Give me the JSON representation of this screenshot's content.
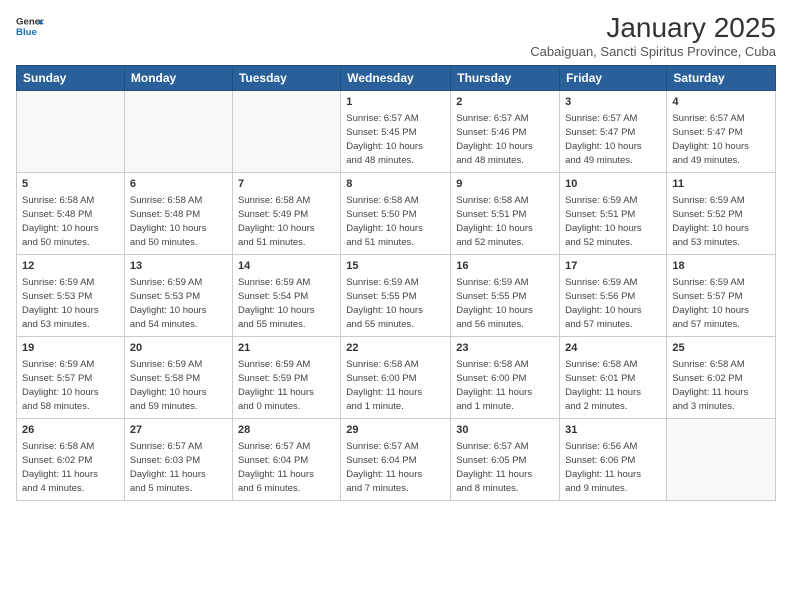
{
  "header": {
    "logo_line1": "General",
    "logo_line2": "Blue",
    "month": "January 2025",
    "location": "Cabaiguan, Sancti Spiritus Province, Cuba"
  },
  "days_of_week": [
    "Sunday",
    "Monday",
    "Tuesday",
    "Wednesday",
    "Thursday",
    "Friday",
    "Saturday"
  ],
  "weeks": [
    [
      {
        "day": "",
        "info": ""
      },
      {
        "day": "",
        "info": ""
      },
      {
        "day": "",
        "info": ""
      },
      {
        "day": "1",
        "info": "Sunrise: 6:57 AM\nSunset: 5:45 PM\nDaylight: 10 hours\nand 48 minutes."
      },
      {
        "day": "2",
        "info": "Sunrise: 6:57 AM\nSunset: 5:46 PM\nDaylight: 10 hours\nand 48 minutes."
      },
      {
        "day": "3",
        "info": "Sunrise: 6:57 AM\nSunset: 5:47 PM\nDaylight: 10 hours\nand 49 minutes."
      },
      {
        "day": "4",
        "info": "Sunrise: 6:57 AM\nSunset: 5:47 PM\nDaylight: 10 hours\nand 49 minutes."
      }
    ],
    [
      {
        "day": "5",
        "info": "Sunrise: 6:58 AM\nSunset: 5:48 PM\nDaylight: 10 hours\nand 50 minutes."
      },
      {
        "day": "6",
        "info": "Sunrise: 6:58 AM\nSunset: 5:48 PM\nDaylight: 10 hours\nand 50 minutes."
      },
      {
        "day": "7",
        "info": "Sunrise: 6:58 AM\nSunset: 5:49 PM\nDaylight: 10 hours\nand 51 minutes."
      },
      {
        "day": "8",
        "info": "Sunrise: 6:58 AM\nSunset: 5:50 PM\nDaylight: 10 hours\nand 51 minutes."
      },
      {
        "day": "9",
        "info": "Sunrise: 6:58 AM\nSunset: 5:51 PM\nDaylight: 10 hours\nand 52 minutes."
      },
      {
        "day": "10",
        "info": "Sunrise: 6:59 AM\nSunset: 5:51 PM\nDaylight: 10 hours\nand 52 minutes."
      },
      {
        "day": "11",
        "info": "Sunrise: 6:59 AM\nSunset: 5:52 PM\nDaylight: 10 hours\nand 53 minutes."
      }
    ],
    [
      {
        "day": "12",
        "info": "Sunrise: 6:59 AM\nSunset: 5:53 PM\nDaylight: 10 hours\nand 53 minutes."
      },
      {
        "day": "13",
        "info": "Sunrise: 6:59 AM\nSunset: 5:53 PM\nDaylight: 10 hours\nand 54 minutes."
      },
      {
        "day": "14",
        "info": "Sunrise: 6:59 AM\nSunset: 5:54 PM\nDaylight: 10 hours\nand 55 minutes."
      },
      {
        "day": "15",
        "info": "Sunrise: 6:59 AM\nSunset: 5:55 PM\nDaylight: 10 hours\nand 55 minutes."
      },
      {
        "day": "16",
        "info": "Sunrise: 6:59 AM\nSunset: 5:55 PM\nDaylight: 10 hours\nand 56 minutes."
      },
      {
        "day": "17",
        "info": "Sunrise: 6:59 AM\nSunset: 5:56 PM\nDaylight: 10 hours\nand 57 minutes."
      },
      {
        "day": "18",
        "info": "Sunrise: 6:59 AM\nSunset: 5:57 PM\nDaylight: 10 hours\nand 57 minutes."
      }
    ],
    [
      {
        "day": "19",
        "info": "Sunrise: 6:59 AM\nSunset: 5:57 PM\nDaylight: 10 hours\nand 58 minutes."
      },
      {
        "day": "20",
        "info": "Sunrise: 6:59 AM\nSunset: 5:58 PM\nDaylight: 10 hours\nand 59 minutes."
      },
      {
        "day": "21",
        "info": "Sunrise: 6:59 AM\nSunset: 5:59 PM\nDaylight: 11 hours\nand 0 minutes."
      },
      {
        "day": "22",
        "info": "Sunrise: 6:58 AM\nSunset: 6:00 PM\nDaylight: 11 hours\nand 1 minute."
      },
      {
        "day": "23",
        "info": "Sunrise: 6:58 AM\nSunset: 6:00 PM\nDaylight: 11 hours\nand 1 minute."
      },
      {
        "day": "24",
        "info": "Sunrise: 6:58 AM\nSunset: 6:01 PM\nDaylight: 11 hours\nand 2 minutes."
      },
      {
        "day": "25",
        "info": "Sunrise: 6:58 AM\nSunset: 6:02 PM\nDaylight: 11 hours\nand 3 minutes."
      }
    ],
    [
      {
        "day": "26",
        "info": "Sunrise: 6:58 AM\nSunset: 6:02 PM\nDaylight: 11 hours\nand 4 minutes."
      },
      {
        "day": "27",
        "info": "Sunrise: 6:57 AM\nSunset: 6:03 PM\nDaylight: 11 hours\nand 5 minutes."
      },
      {
        "day": "28",
        "info": "Sunrise: 6:57 AM\nSunset: 6:04 PM\nDaylight: 11 hours\nand 6 minutes."
      },
      {
        "day": "29",
        "info": "Sunrise: 6:57 AM\nSunset: 6:04 PM\nDaylight: 11 hours\nand 7 minutes."
      },
      {
        "day": "30",
        "info": "Sunrise: 6:57 AM\nSunset: 6:05 PM\nDaylight: 11 hours\nand 8 minutes."
      },
      {
        "day": "31",
        "info": "Sunrise: 6:56 AM\nSunset: 6:06 PM\nDaylight: 11 hours\nand 9 minutes."
      },
      {
        "day": "",
        "info": ""
      }
    ]
  ]
}
